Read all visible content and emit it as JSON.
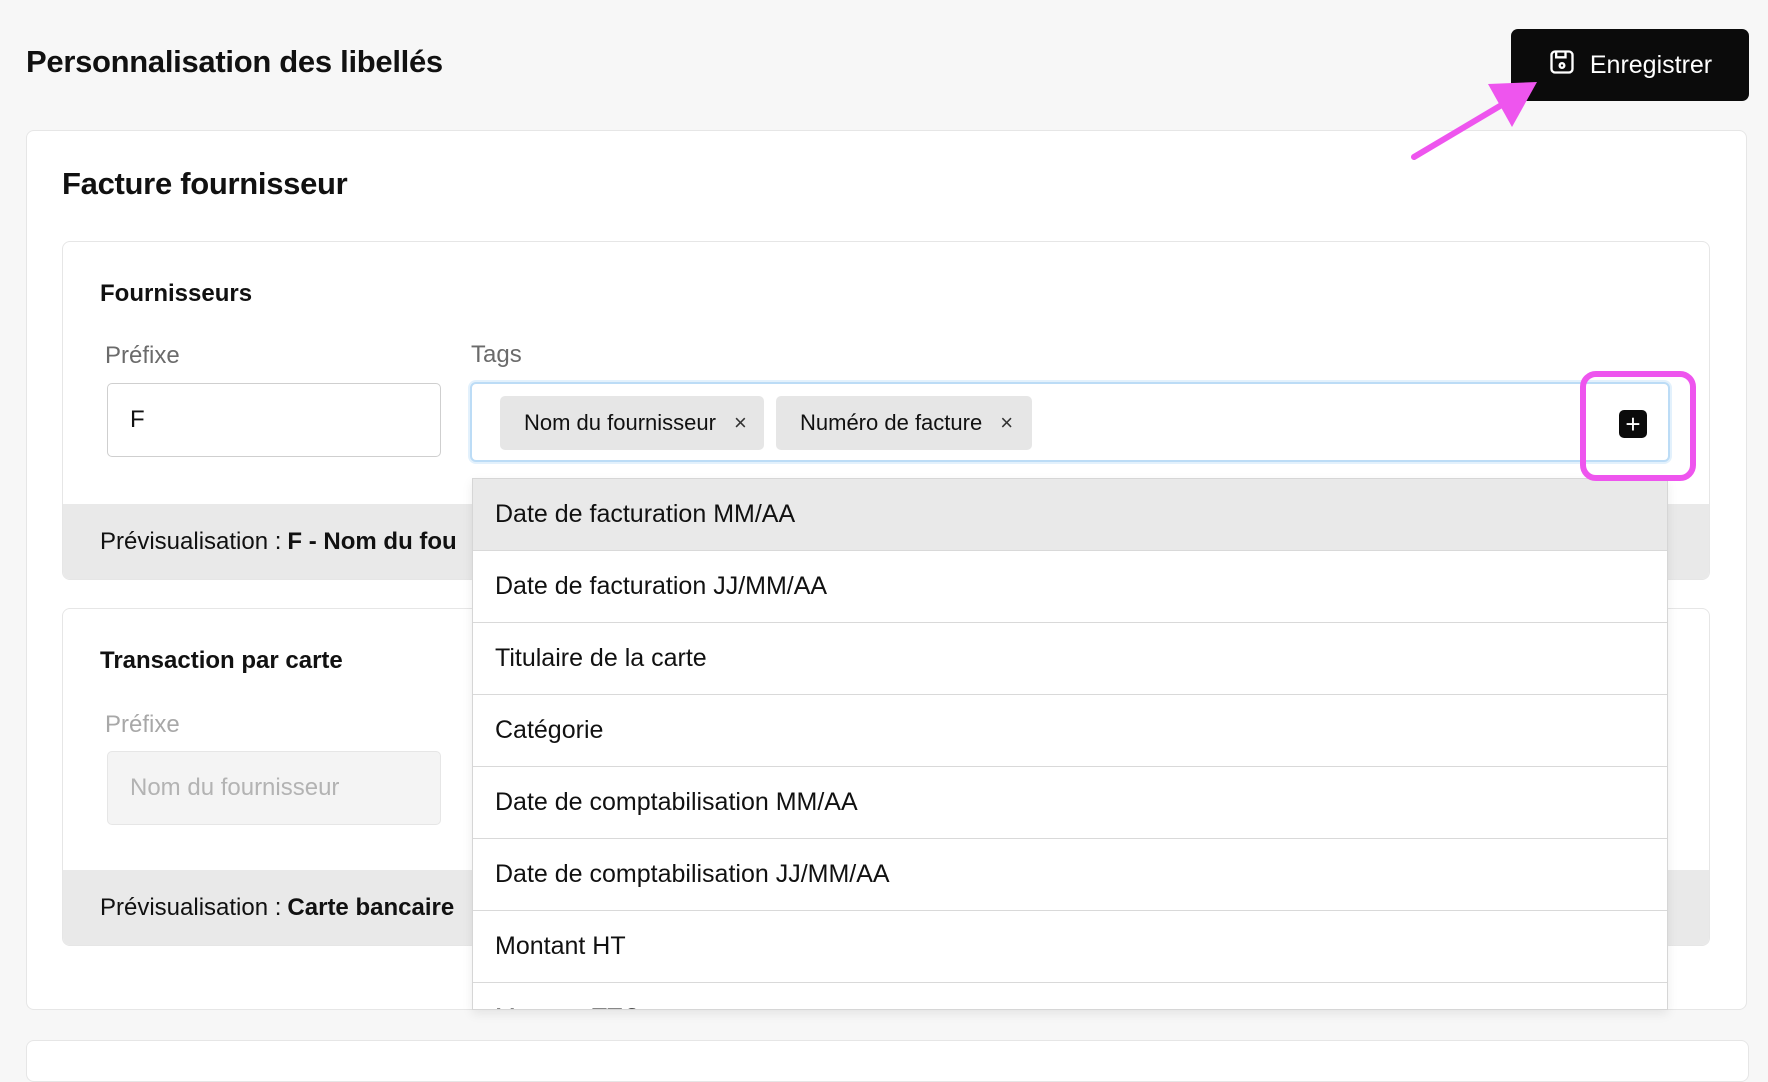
{
  "header": {
    "title": "Personnalisation des libellés",
    "save_label": "Enregistrer"
  },
  "card": {
    "title": "Facture fournisseur"
  },
  "fournisseurs": {
    "title": "Fournisseurs",
    "prefix_label": "Préfixe",
    "prefix_value": "F",
    "tags_label": "Tags",
    "tags": [
      "Nom du fournisseur",
      "Numéro de facture"
    ],
    "remove_glyph": "×",
    "add_glyph": "+",
    "preview_label": "Prévisualisation :",
    "preview_value": "F - Nom du fou"
  },
  "carte": {
    "title": "Transaction par carte",
    "prefix_label": "Préfixe",
    "prefix_placeholder": "Nom du fournisseur",
    "preview_label": "Prévisualisation :",
    "preview_value": "Carte bancaire"
  },
  "dropdown": {
    "options": [
      "Date de facturation MM/AA",
      "Date de facturation JJ/MM/AA",
      "Titulaire de la carte",
      "Catégorie",
      "Date de comptabilisation MM/AA",
      "Date de comptabilisation JJ/MM/AA",
      "Montant HT",
      "Montant TTC"
    ]
  },
  "colors": {
    "highlight": "#ee55ee",
    "button_bg": "#0b0b0b",
    "focus_border": "#bcdcf6"
  }
}
